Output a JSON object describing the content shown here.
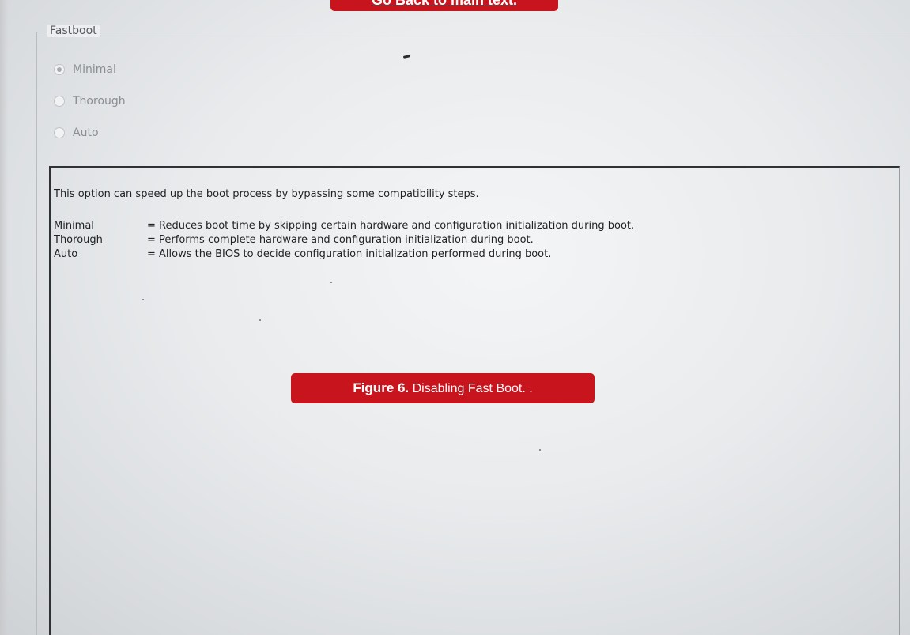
{
  "back_link": {
    "label": "Go Back to main text."
  },
  "fastboot": {
    "legend": "Fastboot",
    "options": [
      {
        "label": "Minimal",
        "selected": true
      },
      {
        "label": "Thorough",
        "selected": false
      },
      {
        "label": "Auto",
        "selected": false
      }
    ]
  },
  "help": {
    "intro": "This option can speed up the boot process by bypassing some compatibility steps.",
    "entries": [
      {
        "term": "Minimal",
        "desc": "= Reduces boot time by skipping certain hardware and configuration initialization during boot."
      },
      {
        "term": "Thorough",
        "desc": "= Performs complete hardware and configuration initialization during boot."
      },
      {
        "term": "Auto",
        "desc": "= Allows the BIOS to decide configuration initialization performed during boot."
      }
    ]
  },
  "caption": {
    "label": "Figure 6.",
    "text": " Disabling Fast Boot. ."
  },
  "colors": {
    "accent": "#c8141c",
    "background": "#e9ebed"
  }
}
